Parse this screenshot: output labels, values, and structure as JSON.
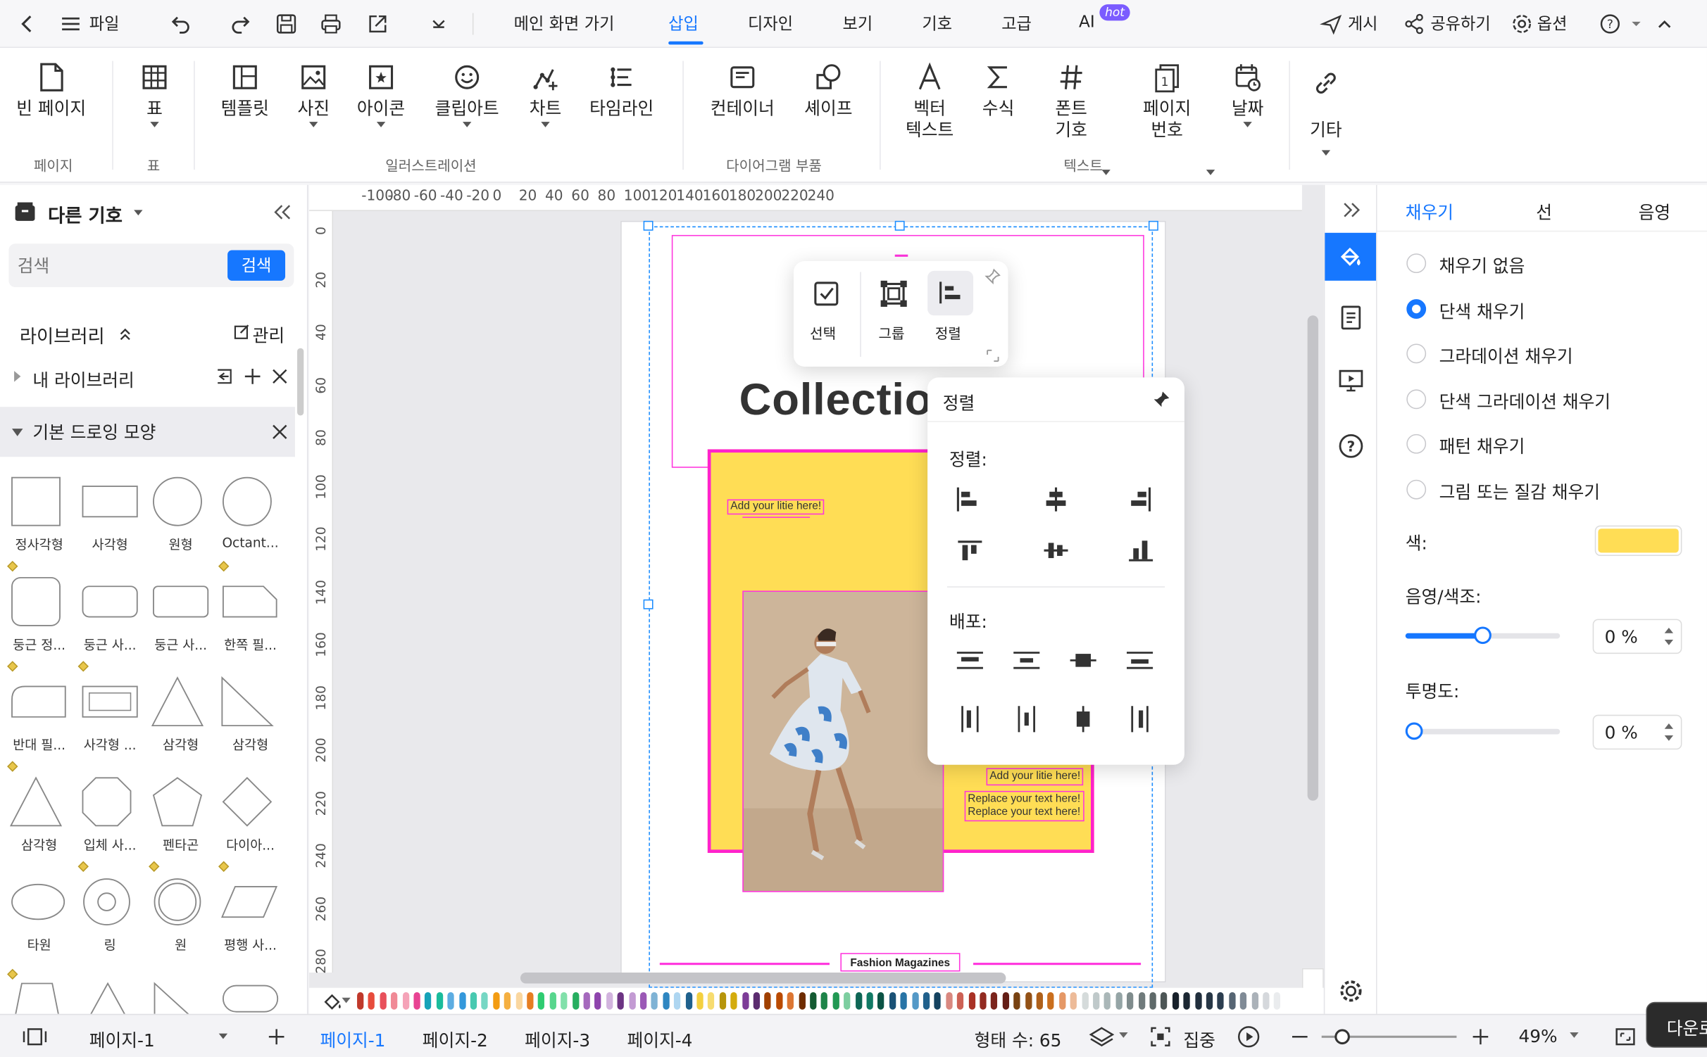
{
  "topbar": {
    "file": "파일",
    "tabs": [
      "메인 화면 가기",
      "삽입",
      "디자인",
      "보기",
      "기호",
      "고급",
      "AI"
    ],
    "hot": "hot",
    "publish": "게시",
    "share": "공유하기",
    "options": "옵션"
  },
  "ribbon": {
    "page": {
      "blank": "빈 페이지",
      "group": "페이지"
    },
    "table": {
      "label": "표",
      "group": "표"
    },
    "illust": {
      "template": "템플릿",
      "photo": "사진",
      "icon": "아이콘",
      "clipart": "클립아트",
      "chart": "차트",
      "timeline": "타임라인",
      "group": "일러스트레이션"
    },
    "diagram": {
      "container": "컨테이너",
      "shape": "셰이프",
      "group": "다이어그램 부품"
    },
    "text": {
      "vector1": "벡터",
      "vector2": "텍스트",
      "formula": "수식",
      "font1": "폰트",
      "font2": "기호",
      "pagenum1": "페이지",
      "pagenum2": "번호",
      "date": "날짜",
      "group": "텍스트"
    },
    "other": "기타"
  },
  "left": {
    "title": "다른 기호",
    "search_placeholder": "검색",
    "search_btn": "검색",
    "library": "라이브러리",
    "manage": "관리",
    "my_library": "내 라이브러리",
    "basic_shapes": "기본 드로잉 모양",
    "shapes": [
      "정사각형",
      "사각형",
      "원형",
      "Octant...",
      "둥근 정...",
      "둥근 사...",
      "둥근 사...",
      "한쪽 필...",
      "반대 필...",
      "사각형 ...",
      "삼각형",
      "삼각형",
      "삼각형",
      "입체 사...",
      "펜타곤",
      "다이아...",
      "타원",
      "링",
      "원",
      "평행 사..."
    ]
  },
  "canvas": {
    "hruler": [
      "-100",
      "-80",
      "-60",
      "-40",
      "-20",
      "0",
      "20",
      "40",
      "60",
      "80",
      "100",
      "120",
      "140",
      "160",
      "180",
      "200",
      "220",
      "240"
    ],
    "vruler": [
      "0",
      "20",
      "40",
      "60",
      "80",
      "100",
      "120",
      "140",
      "160",
      "180",
      "200",
      "220",
      "240",
      "260",
      "280"
    ],
    "collection": "Collectio",
    "add_title": "Add your litie here!",
    "add_title2": "Add your litie here!",
    "replace1": "Replace your text here!",
    "replace2": "Replace your text here!",
    "footer": "Fashion Magazines"
  },
  "toolbar": {
    "select": "선택",
    "group": "그룹",
    "align": "정렬"
  },
  "align_panel": {
    "title": "정렬",
    "align_label": "정렬:",
    "distribute_label": "배포:"
  },
  "right": {
    "tabs": [
      "채우기",
      "선",
      "음영"
    ],
    "options": [
      "채우기 없음",
      "단색 채우기",
      "그라데이션 채우기",
      "단색 그라데이션 채우기",
      "패턴 채우기",
      "그림 또는 질감 채우기"
    ],
    "selected_index": 1,
    "color_label": "색:",
    "fill_color": "#ffdd55",
    "shade_label": "음영/색조:",
    "shade_value": "0 %",
    "shade_level": 0.5,
    "transparency_label": "투명도:",
    "transparency_value": "0 %",
    "transparency_level": 0
  },
  "status": {
    "page_select": "페이지-1",
    "pages": [
      "페이지-1",
      "페이지-2",
      "페이지-3",
      "페이지-4"
    ],
    "shape_count": "형태 수: 65",
    "focus": "집중",
    "zoom": "49%",
    "download": "다운로"
  },
  "palette": [
    "#c0392b",
    "#e74c3c",
    "#e8505b",
    "#f08a96",
    "#f5a3b8",
    "#e84393",
    "#17a2b8",
    "#1abc9c",
    "#5dade2",
    "#3498db",
    "#48c9b0",
    "#76d7c4",
    "#f39c12",
    "#f5b041",
    "#fad7a0",
    "#e67e22",
    "#2ecc71",
    "#58d68d",
    "#82e0aa",
    "#27ae60",
    "#a569bd",
    "#8e44ad",
    "#d2b4de",
    "#6c3483",
    "#c39bd3",
    "#9b59b6",
    "#7fb3d5",
    "#2e86c1",
    "#aed6f1",
    "#1f618d",
    "#f4d03f",
    "#f7dc6f",
    "#b7950b",
    "#d4ac0d",
    "#7d3c98",
    "#5b2c6f",
    "#a04000",
    "#ba4a00",
    "#dc7633",
    "#6e2c00",
    "#145a32",
    "#1e8449",
    "#229954",
    "#7dcea0",
    "#0e6655",
    "#117a65",
    "#0b5345",
    "#1a5276",
    "#2874a6",
    "#5499c7",
    "#21618c",
    "#154360",
    "#d98880",
    "#cd6155",
    "#a93226",
    "#922b21",
    "#7b241c",
    "#641e16",
    "#784212",
    "#935116",
    "#af601a",
    "#ca6f1e",
    "#e59866",
    "#edbb99",
    "#d5dbdb",
    "#bfc9ca",
    "#aab7b8",
    "#95a5a6",
    "#7f8c8d",
    "#707b7c",
    "#5f6a6a",
    "#4d5656",
    "#17202a",
    "#1c2833",
    "#212f3d",
    "#273746",
    "#2c3e50",
    "#566573",
    "#808b96",
    "#abb2b9",
    "#d5d8dc",
    "#eaecee"
  ]
}
